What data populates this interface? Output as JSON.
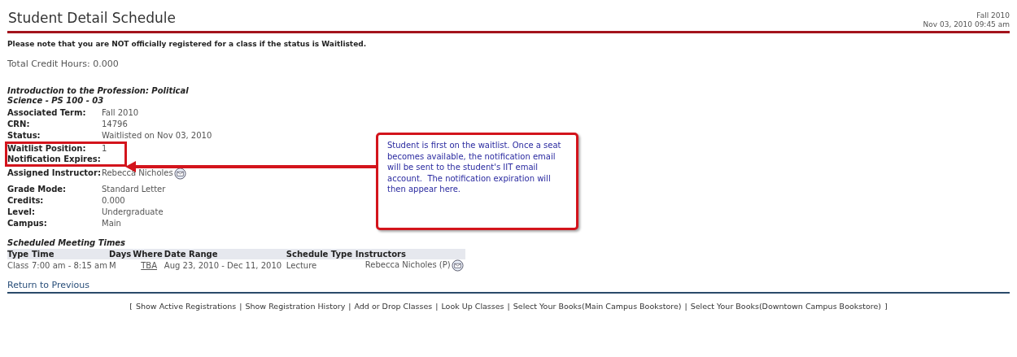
{
  "header": {
    "title": "Student Detail Schedule",
    "term": "Fall 2010",
    "timestamp": "Nov 03, 2010 09:45 am"
  },
  "notice": "Please note that you are NOT officially registered for a class if the status is Waitlisted.",
  "total_credit_hours": "Total Credit Hours: 0.000",
  "course": {
    "title": "Introduction to the Profession: Political Science - PS 100 - 03",
    "fields": [
      {
        "kind": "row",
        "label": "Associated Term:",
        "value": "Fall 2010",
        "highlighted": false
      },
      {
        "kind": "row",
        "label": "CRN:",
        "value": "14796",
        "highlighted": false
      },
      {
        "kind": "row",
        "label": "Status:",
        "value": "Waitlisted on Nov 03, 2010",
        "highlighted": false
      },
      {
        "kind": "row",
        "label": "Waitlist Position:",
        "value": "1",
        "highlighted": true
      },
      {
        "kind": "row",
        "label": "Notification Expires:",
        "highlighted": true
      },
      {
        "kind": "instructor",
        "label": "Assigned Instructor:",
        "value": "Rebecca Nicholes",
        "highlighted": false
      },
      {
        "kind": "row",
        "label": "Grade Mode:",
        "value": "Standard Letter",
        "highlighted": false
      },
      {
        "kind": "row",
        "label": "Credits:",
        "value": "0.000",
        "highlighted": false
      },
      {
        "kind": "row",
        "label": "Level:",
        "value": "Undergraduate",
        "highlighted": false
      },
      {
        "kind": "row",
        "label": "Campus:",
        "value": "Main",
        "highlighted": false
      }
    ]
  },
  "callout": "Student is first on the waitlist. Once a seat becomes available, the notification email will be sent to the student's IIT email account.  The notification expiration will then appear here.",
  "meeting_times": {
    "heading": "Scheduled Meeting Times",
    "columns": [
      "Type",
      "Time",
      "Days",
      "Where",
      "Date Range",
      "Schedule Type",
      "Instructors"
    ],
    "rows": [
      [
        "Class",
        "7:00 am - 8:15 am",
        "M",
        "TBA",
        "Aug 23, 2010 - Dec 11, 2010",
        "Lecture",
        "Rebecca Nicholes (P)"
      ]
    ]
  },
  "return_link": "Return to Previous",
  "footer": {
    "open": "[",
    "close": "]",
    "separator": "|",
    "links": [
      "Show Active Registrations",
      "Show Registration History",
      "Add or Drop Classes",
      "Look Up Classes",
      "Select Your Books(Main Campus Bookstore)",
      "Select Your Books(Downtown Campus Bookstore)"
    ]
  }
}
